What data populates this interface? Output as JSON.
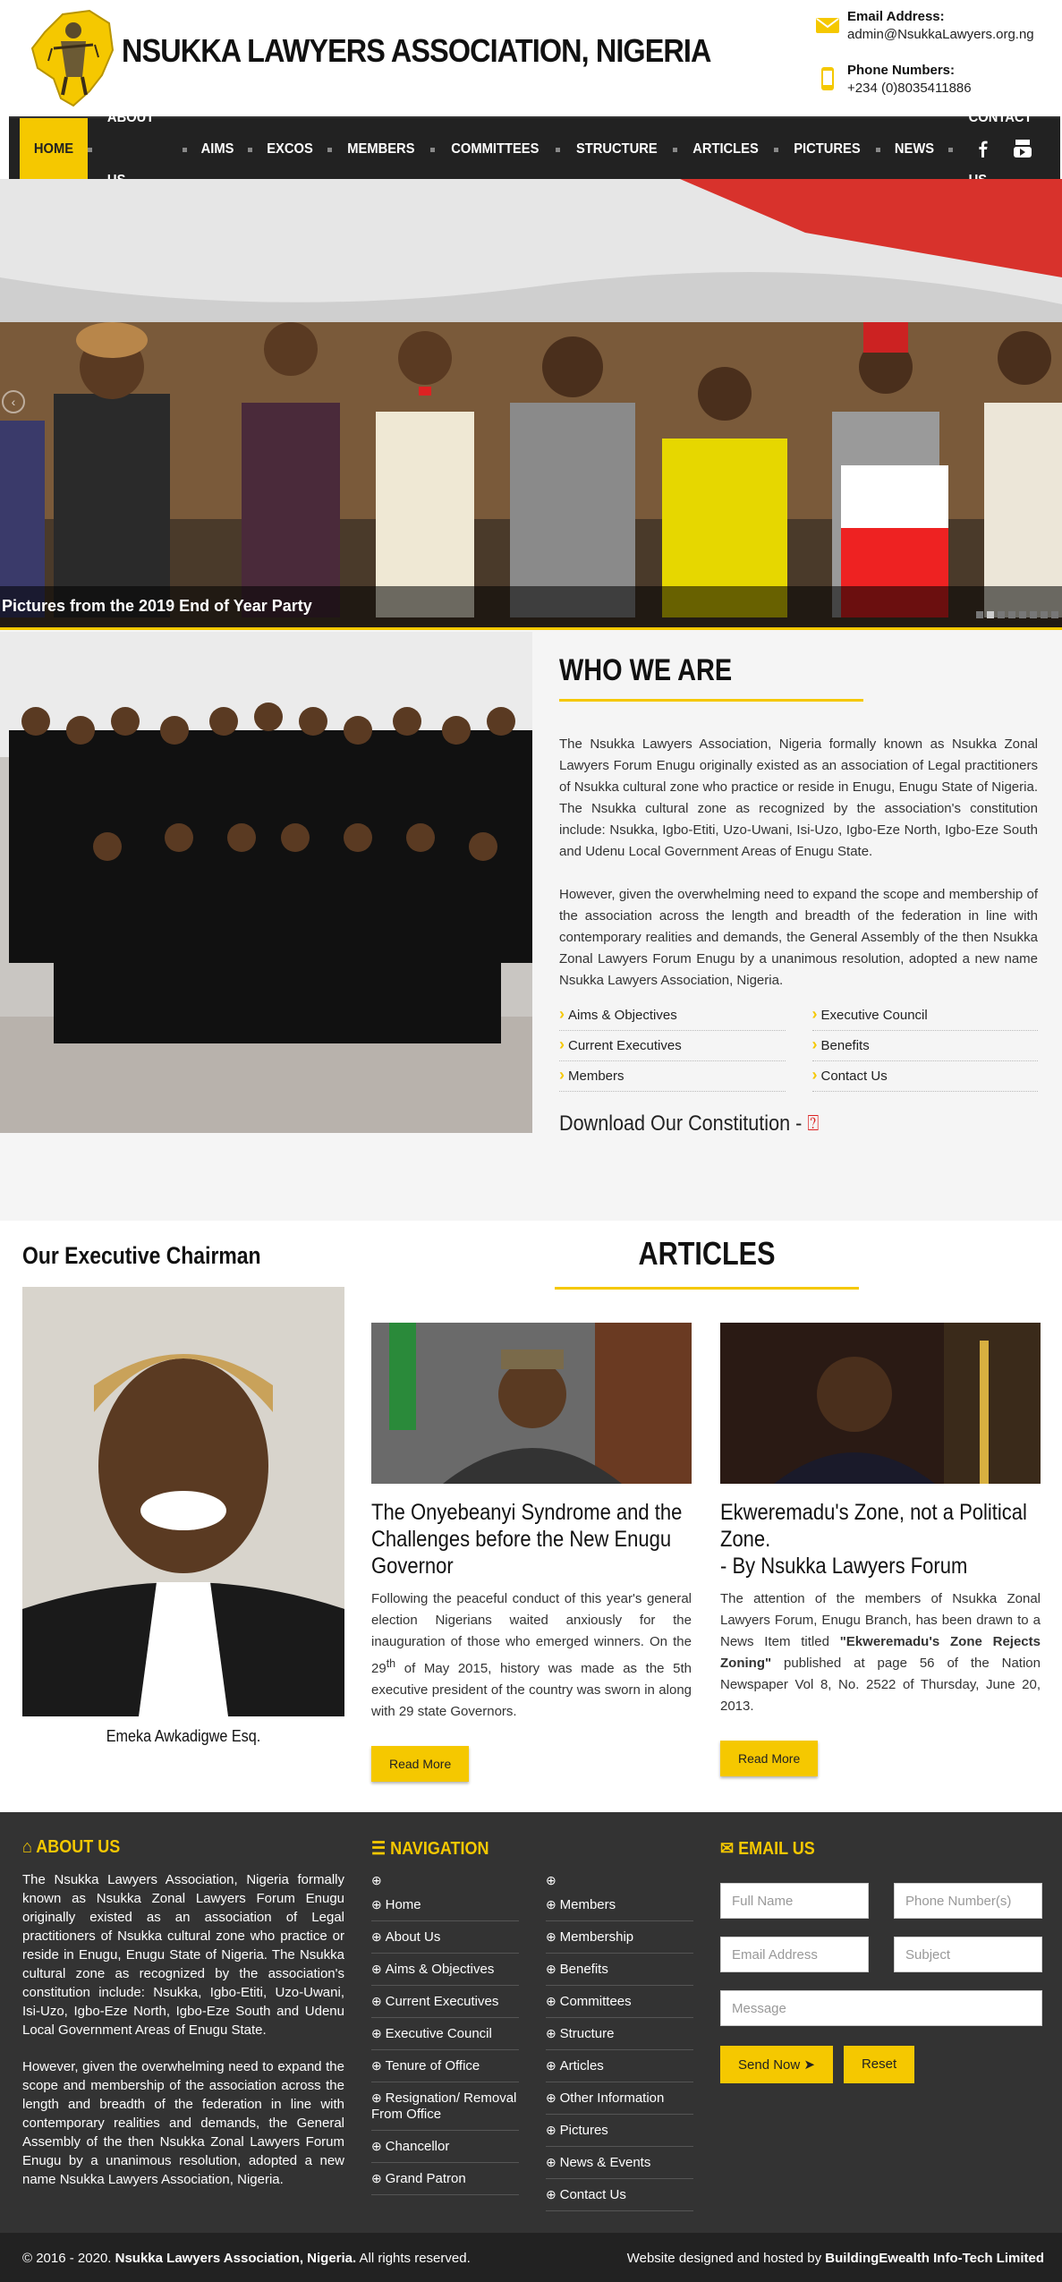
{
  "header": {
    "title": "NSUKKA LAWYERS ASSOCIATION, NIGERIA",
    "email_label": "Email Address:",
    "email_value": "admin@NsukkaLawyers.org.ng",
    "phone_label": "Phone Numbers:",
    "phone_value": "+234 (0)8035411886"
  },
  "nav": {
    "items": [
      "HOME",
      "ABOUT US",
      "AIMS",
      "EXCOS",
      "MEMBERS",
      "COMMITTEES",
      "STRUCTURE",
      "ARTICLES",
      "PICTURES",
      "NEWS",
      "CONTACT US"
    ],
    "active": "HOME",
    "social": [
      "facebook-icon",
      "youtube-icon"
    ]
  },
  "slider": {
    "caption": "Pictures from the 2019 End of Year Party",
    "slide_count": 8,
    "active_slide": 2
  },
  "who": {
    "heading": "WHO WE ARE",
    "para1": "The Nsukka Lawyers Association, Nigeria formally known as Nsukka Zonal Lawyers Forum Enugu originally existed as an association of Legal practitioners of Nsukka cultural zone who practice or reside in Enugu, Enugu State of Nigeria. The Nsukka cultural zone as recognized by the association's constitution include: Nsukka, Igbo-Etiti, Uzo-Uwani, Isi-Uzo, Igbo-Eze North, Igbo-Eze South and Udenu Local Government Areas of Enugu State.",
    "para2": "However, given the overwhelming need to expand the scope and membership of the association across the length and breadth of the federation in line with contemporary realities and demands, the General Assembly of the then Nsukka Zonal Lawyers Forum Enugu by a unanimous resolution, adopted a new name Nsukka Lawyers Association, Nigeria.",
    "links": [
      "Aims & Objectives",
      "Executive Council",
      "Current Executives",
      "Benefits",
      "Members",
      "Contact Us"
    ],
    "download": "Download Our Constitution -"
  },
  "chairman": {
    "heading": "Our Executive Chairman",
    "name": "Emeka Awkadigwe Esq."
  },
  "articles": {
    "heading": "ARTICLES",
    "items": [
      {
        "title": "The Onyebeanyi Syndrome and the Challenges before the New Enugu Governor",
        "excerpt_a": "Following the peaceful conduct of this year's general election Nigerians waited anxiously for the inauguration of those who emerged winners. On the 29",
        "excerpt_sup": "th",
        "excerpt_b": " of May 2015, history was made as the 5th executive president of the country was sworn in along with 29 state Governors.",
        "button": "Read More"
      },
      {
        "title": "Ekweremadu's Zone, not a Political Zone.",
        "subtitle": "- By Nsukka Lawyers Forum",
        "excerpt_a": "The attention of the members of Nsukka Zonal Lawyers Forum, Enugu Branch, has been drawn to a News Item titled ",
        "excerpt_bold": "\"Ekweremadu's Zone Rejects Zoning\"",
        "excerpt_b": " published at page 56 of the Nation Newspaper Vol 8, No. 2522 of Thursday, June 20, 2013.",
        "button": "Read More"
      }
    ]
  },
  "footer": {
    "about_heading": "ABOUT US",
    "about_p1": "The Nsukka Lawyers Association, Nigeria formally known as Nsukka Zonal Lawyers Forum Enugu originally existed as an association of Legal practitioners of Nsukka cultural zone who practice or reside in Enugu, Enugu State of Nigeria. The Nsukka cultural zone as recognized by the association's constitution include: Nsukka, Igbo-Etiti, Uzo-Uwani, Isi-Uzo, Igbo-Eze North, Igbo-Eze South and Udenu Local Government Areas of Enugu State.",
    "about_p2": "However, given the overwhelming need to expand the scope and membership of the association across the length and breadth of the federation in line with contemporary realities and demands, the General Assembly of the then Nsukka Zonal Lawyers Forum Enugu by a unanimous resolution, adopted a new name Nsukka Lawyers Association, Nigeria.",
    "nav_heading": "NAVIGATION",
    "nav_left": [
      "Home",
      "About Us",
      "Aims & Objectives",
      "Current Executives",
      "Executive Council",
      "Tenure of Office",
      "Resignation/ Removal From Office",
      "Chancellor",
      "Grand Patron"
    ],
    "nav_right": [
      "Members",
      "Membership",
      "Benefits",
      "Committees",
      "Structure",
      "Articles",
      "Other Information",
      "Pictures",
      "News & Events",
      "Contact Us"
    ],
    "email_heading": "EMAIL US",
    "form": {
      "name": "Full Name",
      "phone": "Phone Number(s)",
      "email": "Email Address",
      "subject": "Subject",
      "message": "Message",
      "send": "Send Now ➤",
      "reset": "Reset"
    }
  },
  "bottom": {
    "copy_a": "© 2016 - 2020. ",
    "copy_b": "Nsukka Lawyers Association, Nigeria.",
    "copy_c": " All rights reserved.",
    "credit_a": "Website designed and hosted by ",
    "credit_b": "BuildingEwealth Info-Tech Limited"
  },
  "colors": {
    "accent": "#f5c800",
    "nav_bg": "#222222",
    "footer_bg": "#333333"
  }
}
